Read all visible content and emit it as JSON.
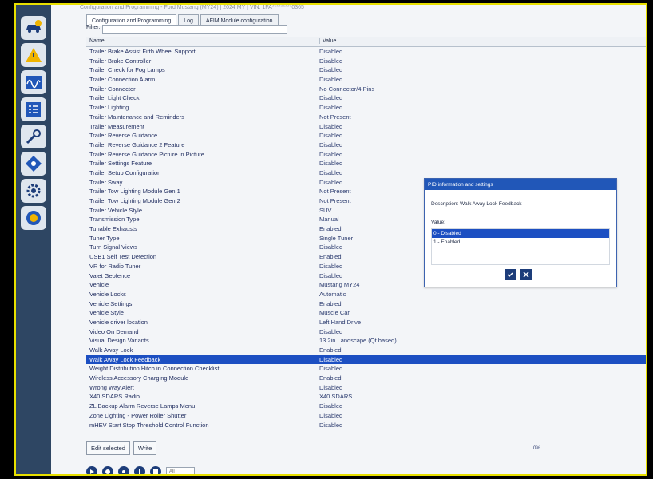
{
  "titlebar": "Configuration and Programming - Ford Mustang (MY24) | 2024 MY | VIN: 1FA*********0365",
  "tabs": [
    {
      "label": "Configuration and Programming"
    },
    {
      "label": "Log"
    },
    {
      "label": "AFIM Module configuration"
    }
  ],
  "filter": {
    "label": "Filter:",
    "value": ""
  },
  "grid": {
    "name_header": "Name",
    "value_header": "Value"
  },
  "rows": [
    {
      "name": "Trailer Brake Assist Fifth Wheel Support",
      "value": "Disabled"
    },
    {
      "name": "Trailer Brake Controller",
      "value": "Disabled"
    },
    {
      "name": "Trailer Check for Fog Lamps",
      "value": "Disabled"
    },
    {
      "name": "Trailer Connection Alarm",
      "value": "Disabled"
    },
    {
      "name": "Trailer Connector",
      "value": "No Connector/4 Pins"
    },
    {
      "name": "Trailer Light Check",
      "value": "Disabled"
    },
    {
      "name": "Trailer Lighting",
      "value": "Disabled"
    },
    {
      "name": "Trailer Maintenance and Reminders",
      "value": "Not Present"
    },
    {
      "name": "Trailer Measurement",
      "value": "Disabled"
    },
    {
      "name": "Trailer Reverse Guidance",
      "value": "Disabled"
    },
    {
      "name": "Trailer Reverse Guidance 2 Feature",
      "value": "Disabled"
    },
    {
      "name": "Trailer Reverse Guidance Picture in Picture",
      "value": "Disabled"
    },
    {
      "name": "Trailer Settings Feature",
      "value": "Disabled"
    },
    {
      "name": "Trailer Setup Configuration",
      "value": "Disabled"
    },
    {
      "name": "Trailer Sway",
      "value": "Disabled"
    },
    {
      "name": "Trailer Tow Lighting Module Gen 1",
      "value": "Not Present"
    },
    {
      "name": "Trailer Tow Lighting Module Gen 2",
      "value": "Not Present"
    },
    {
      "name": "Trailer Vehicle Style",
      "value": "SUV"
    },
    {
      "name": "Transmission Type",
      "value": "Manual"
    },
    {
      "name": "Tunable Exhausts",
      "value": "Enabled"
    },
    {
      "name": "Tuner Type",
      "value": "Single Tuner"
    },
    {
      "name": "Turn Signal Views",
      "value": "Disabled"
    },
    {
      "name": "USB1 Self Test Detection",
      "value": "Enabled"
    },
    {
      "name": "VR for Radio Tuner",
      "value": "Disabled"
    },
    {
      "name": "Valet Geofence",
      "value": "Disabled"
    },
    {
      "name": "Vehicle",
      "value": "Mustang MY24"
    },
    {
      "name": "Vehicle Locks",
      "value": "Automatic"
    },
    {
      "name": "Vehicle Settings",
      "value": "Enabled"
    },
    {
      "name": "Vehicle Style",
      "value": "Muscle Car"
    },
    {
      "name": "Vehicle driver location",
      "value": "Left Hand Drive"
    },
    {
      "name": "Video On Demand",
      "value": "Disabled"
    },
    {
      "name": "Visual Design Variants",
      "value": "13.2in Landscape (Qt based)"
    },
    {
      "name": "Walk Away Lock",
      "value": "Enabled"
    },
    {
      "name": "Walk Away Lock Feedback",
      "value": "Disabled",
      "selected": true
    },
    {
      "name": "Weight Distribution Hitch in Connection Checklist",
      "value": "Disabled"
    },
    {
      "name": "Wireless Accessory Charging Module",
      "value": "Enabled"
    },
    {
      "name": "Wrong Way Alert",
      "value": "Disabled"
    },
    {
      "name": "X40 SDARS Radio",
      "value": "X40 SDARS"
    },
    {
      "name": "ZL Backup Alarm Reverse Lamps Menu",
      "value": "Disabled"
    },
    {
      "name": "Zone Lighting - Power Roller Shutter",
      "value": "Disabled"
    },
    {
      "name": "mHEV Start Stop Threshold Control Function",
      "value": "Disabled"
    }
  ],
  "buttons": {
    "edit_selected": "Edit selected",
    "write": "Write"
  },
  "progress": {
    "percent_text": "0%"
  },
  "toolbar": {
    "select_value": "All"
  },
  "dialog": {
    "title": "PID information and settings",
    "description": "Description: Walk Away Lock Feedback",
    "value_label": "Value:",
    "options": [
      {
        "label": "0 - Disabled",
        "selected": true
      },
      {
        "label": "1 - Enabled",
        "selected": false
      }
    ]
  },
  "colors": {
    "accent": "#1c4fc2",
    "sidebar": "#2e4663",
    "highlight_border": "#e8e000"
  }
}
